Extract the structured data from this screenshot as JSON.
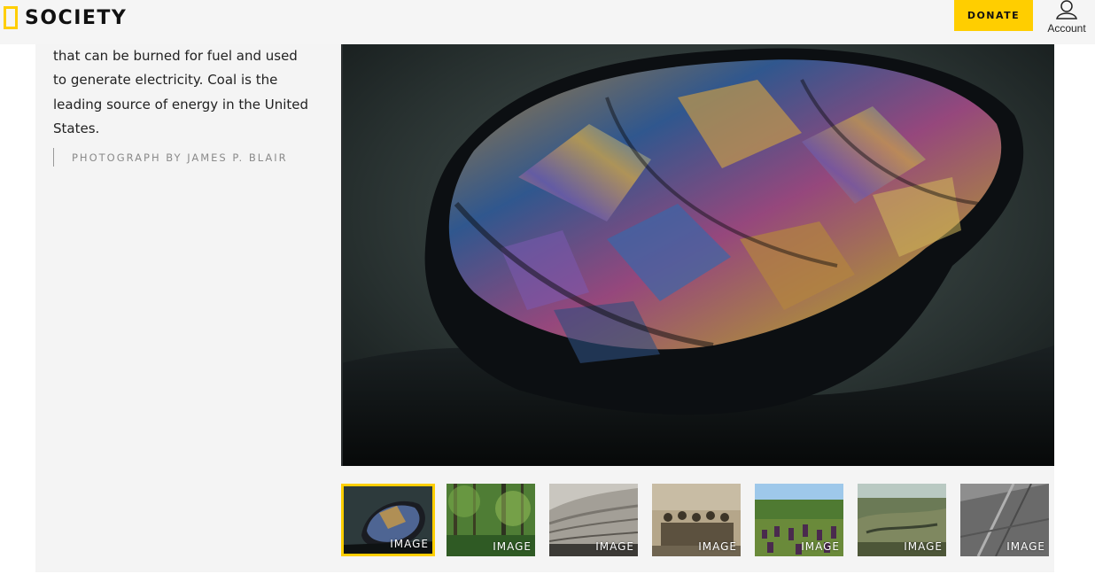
{
  "header": {
    "logo_text": "SOCIETY",
    "donate_label": "DONATE",
    "account_label": "Account"
  },
  "caption": {
    "text": "that can be burned for fuel and used to generate electricity. Coal is the leading source of energy in the United States.",
    "credit": "PHOTOGRAPH BY JAMES P. BLAIR"
  },
  "thumbnails": [
    {
      "label": "IMAGE",
      "subject": "coal lump",
      "active": true
    },
    {
      "label": "IMAGE",
      "subject": "forest"
    },
    {
      "label": "IMAGE",
      "subject": "rock strata"
    },
    {
      "label": "IMAGE",
      "subject": "miners sepia"
    },
    {
      "label": "IMAGE",
      "subject": "peat field"
    },
    {
      "label": "IMAGE",
      "subject": "landscape"
    },
    {
      "label": "IMAGE",
      "subject": "mine aerial"
    }
  ],
  "colors": {
    "accent": "#ffce00",
    "header_bg": "#f5f5f5",
    "panel_bg": "#f4f4f4"
  }
}
